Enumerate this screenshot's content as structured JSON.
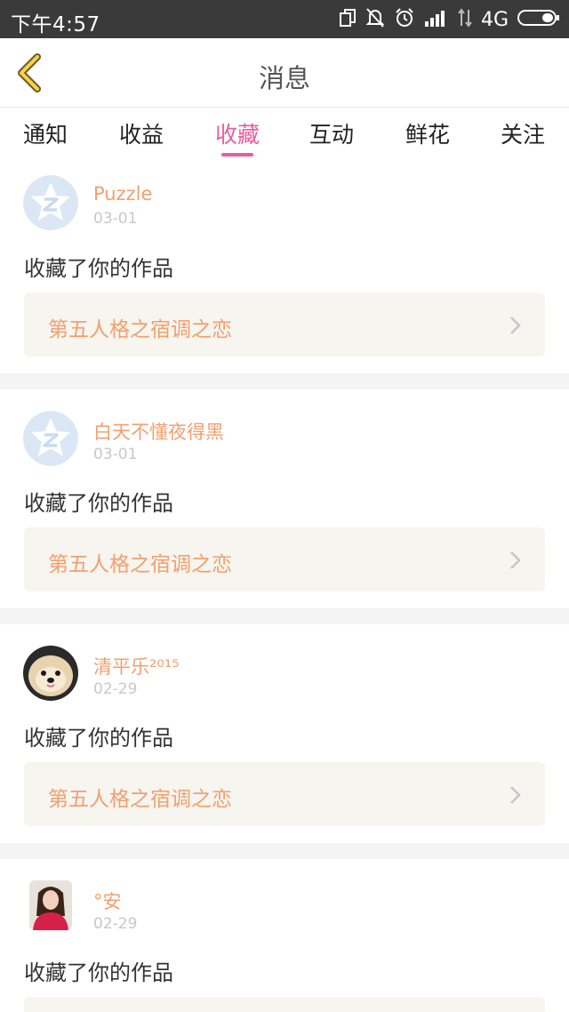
{
  "status_bar": {
    "time": "下午4:57",
    "network": "4G",
    "icons": [
      "copy-icon",
      "bell-off-icon",
      "alarm-icon",
      "signal-icon",
      "data-arrows-icon",
      "battery-icon"
    ]
  },
  "header": {
    "title": "消息",
    "back_icon": "chevron-left-icon"
  },
  "tabs": [
    {
      "label": "通知"
    },
    {
      "label": "收益"
    },
    {
      "label": "收藏",
      "active": true
    },
    {
      "label": "互动"
    },
    {
      "label": "鲜花"
    },
    {
      "label": "关注"
    }
  ],
  "colors": {
    "accent": "#e65ea0",
    "username": "#f0a070",
    "work_title": "#f0a070",
    "date": "#c8c8c8",
    "work_box_bg": "#f6f5ef",
    "status_bar": "#3a3a3a"
  },
  "items": [
    {
      "username": "Puzzle",
      "date": "03-01",
      "action": "收藏了你的作品",
      "work_title": "第五人格之宿调之恋",
      "avatar": "qq-default-avatar"
    },
    {
      "username": "白天不懂夜得黑",
      "date": "03-01",
      "action": "收藏了你的作品",
      "work_title": "第五人格之宿调之恋",
      "avatar": "qq-default-avatar"
    },
    {
      "username": "清平乐²⁰¹⁵",
      "date": "02-29",
      "action": "收藏了你的作品",
      "work_title": "第五人格之宿调之恋",
      "avatar": "dog-photo-avatar"
    },
    {
      "username": "°安",
      "date": "02-29",
      "action": "收藏了你的作品",
      "work_title": "",
      "avatar": "girl-photo-avatar"
    }
  ]
}
